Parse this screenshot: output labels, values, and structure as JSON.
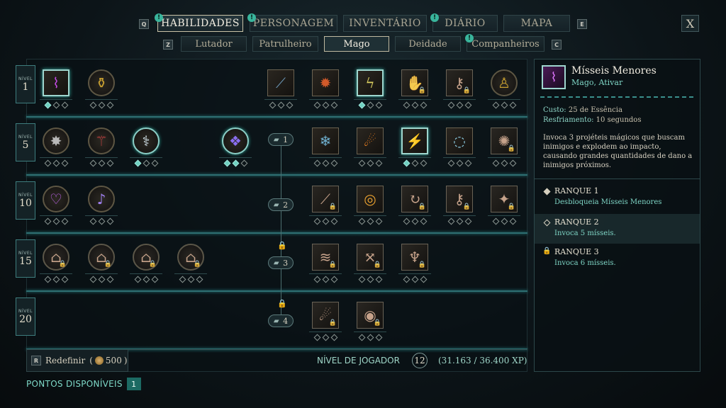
{
  "nav": {
    "keys": {
      "left": "Q",
      "right": "E",
      "sub_left": "Z",
      "sub_right": "C"
    },
    "tabs": [
      {
        "label": "HABILIDADES",
        "active": true,
        "notify": true
      },
      {
        "label": "PERSONAGEM",
        "active": false,
        "notify": true
      },
      {
        "label": "INVENTÁRIO",
        "active": false,
        "notify": false
      },
      {
        "label": "DIÁRIO",
        "active": false,
        "notify": true
      },
      {
        "label": "MAPA",
        "active": false,
        "notify": false
      }
    ],
    "close": "X",
    "notify_glyph": "!",
    "subtabs": [
      {
        "label": "Lutador",
        "active": false
      },
      {
        "label": "Patrulheiro",
        "active": false
      },
      {
        "label": "Mago",
        "active": true
      },
      {
        "label": "Deidade",
        "active": false
      },
      {
        "label": "Companheiros",
        "active": false,
        "notify": true
      }
    ]
  },
  "tree": {
    "level_word": "NÍVEL",
    "levels": [
      "1",
      "5",
      "10",
      "15",
      "20"
    ],
    "passive_points": [
      "1",
      "2",
      "3",
      "4"
    ],
    "skills": [
      {
        "icon": "arcane-tentacles-icon",
        "level": "1",
        "shape": "square",
        "active": true,
        "ranks": 1,
        "color": "#c04ae0",
        "glyph": "⌇"
      },
      {
        "icon": "golden-armor-icon",
        "level": "1",
        "shape": "circle",
        "active": false,
        "ranks": 0,
        "color": "#c9a030",
        "glyph": "⚱"
      },
      {
        "icon": "claw-slash-icon",
        "level": "1",
        "shape": "square",
        "active": false,
        "ranks": 0,
        "color": "#6c98b8",
        "glyph": "⟋"
      },
      {
        "icon": "fan-fire-icon",
        "level": "1",
        "shape": "square",
        "active": false,
        "ranks": 0,
        "color": "#d25a2a",
        "glyph": "✹"
      },
      {
        "icon": "lightning-bolts-icon",
        "level": "1",
        "shape": "square",
        "active": true,
        "ranks": 1,
        "color": "#dcd060",
        "glyph": "ϟ"
      },
      {
        "icon": "locked-hand-icon",
        "level": "1",
        "shape": "square",
        "locked": true,
        "ranks": 0,
        "color": "#d0a080",
        "glyph": "✋"
      },
      {
        "icon": "locked-wand-icon",
        "level": "1",
        "shape": "square",
        "locked": true,
        "ranks": 0,
        "color": "#d0a080",
        "glyph": "⚷"
      },
      {
        "icon": "golden-figure-icon",
        "level": "1",
        "shape": "circle",
        "active": false,
        "ranks": 0,
        "color": "#c9a030",
        "glyph": "♙"
      },
      {
        "icon": "spike-burst-icon",
        "level": "5",
        "shape": "circle",
        "active": false,
        "ranks": 0,
        "color": "#b8b8b8",
        "glyph": "✸"
      },
      {
        "icon": "crimson-wand-icon",
        "level": "5",
        "shape": "circle",
        "active": false,
        "ranks": 0,
        "color": "#c04040",
        "glyph": "⚚"
      },
      {
        "icon": "frost-staff-icon",
        "level": "5",
        "shape": "circle",
        "active": true,
        "ranks": 1,
        "color": "#d0e0e8",
        "glyph": "⚕"
      },
      {
        "icon": "spellbook-icon",
        "level": "5",
        "shape": "circle",
        "active": true,
        "ranks": 2,
        "color": "#8a6ef0",
        "glyph": "❖"
      },
      {
        "icon": "ice-shards-icon",
        "level": "5",
        "shape": "square",
        "active": false,
        "ranks": 0,
        "color": "#6fb0d0",
        "glyph": "❄"
      },
      {
        "icon": "fireball-icon",
        "level": "5",
        "shape": "square",
        "active": false,
        "ranks": 0,
        "color": "#f08020",
        "glyph": "☄"
      },
      {
        "icon": "lightning-chain-icon",
        "level": "5",
        "shape": "square",
        "active": true,
        "ranks": 1,
        "color": "#f0d060",
        "glyph": "⚡"
      },
      {
        "icon": "frost-ring-icon",
        "level": "5",
        "shape": "square",
        "active": false,
        "ranks": 0,
        "color": "#8fd0e8",
        "glyph": "◌"
      },
      {
        "icon": "locked-shatter-icon",
        "level": "5",
        "shape": "square",
        "locked": true,
        "ranks": 0,
        "color": "#d0a080",
        "glyph": "✺"
      },
      {
        "icon": "arcane-heart-icon",
        "level": "10",
        "shape": "circle",
        "active": false,
        "ranks": 0,
        "color": "#c064f0",
        "glyph": "♡"
      },
      {
        "icon": "arcane-swirl-icon",
        "level": "10",
        "shape": "circle",
        "active": false,
        "ranks": 0,
        "color": "#a080f0",
        "glyph": "♪"
      },
      {
        "icon": "locked-claws-icon",
        "level": "10",
        "shape": "square",
        "locked": true,
        "ranks": 0,
        "color": "#d0a080",
        "glyph": "⟋"
      },
      {
        "icon": "fire-ring-icon",
        "level": "10",
        "shape": "square",
        "active": false,
        "ranks": 0,
        "color": "#e8a030",
        "glyph": "◎"
      },
      {
        "icon": "locked-spiral-icon",
        "level": "10",
        "shape": "square",
        "locked": true,
        "ranks": 0,
        "color": "#d0a080",
        "glyph": "↻"
      },
      {
        "icon": "locked-staff-icon",
        "level": "10",
        "shape": "square",
        "locked": true,
        "ranks": 0,
        "color": "#d0a080",
        "glyph": "⚷"
      },
      {
        "icon": "locked-lantern-icon",
        "level": "10",
        "shape": "square",
        "locked": true,
        "ranks": 0,
        "color": "#d0a080",
        "glyph": "✦"
      },
      {
        "icon": "locked-shrine-icon",
        "level": "15",
        "shape": "circle",
        "locked": true,
        "ranks": 0,
        "color": "#d0a080",
        "glyph": "⌂"
      },
      {
        "icon": "locked-shrine-icon",
        "level": "15",
        "shape": "circle",
        "locked": true,
        "ranks": 0,
        "color": "#d0a080",
        "glyph": "⌂"
      },
      {
        "icon": "locked-shrine-icon",
        "level": "15",
        "shape": "circle",
        "locked": true,
        "ranks": 0,
        "color": "#d0a080",
        "glyph": "⌂"
      },
      {
        "icon": "locked-shrine-icon",
        "level": "15",
        "shape": "circle",
        "locked": true,
        "ranks": 0,
        "color": "#d0a080",
        "glyph": "⌂"
      },
      {
        "icon": "locked-wave-icon",
        "level": "15",
        "shape": "square",
        "locked": true,
        "ranks": 0,
        "color": "#d0a080",
        "glyph": "≋"
      },
      {
        "icon": "locked-arrows-icon",
        "level": "15",
        "shape": "square",
        "locked": true,
        "ranks": 0,
        "color": "#d0a080",
        "glyph": "⤧"
      },
      {
        "icon": "locked-totem-icon",
        "level": "15",
        "shape": "square",
        "locked": true,
        "ranks": 0,
        "color": "#d0a080",
        "glyph": "♆"
      },
      {
        "icon": "locked-meteor-icon",
        "level": "20",
        "shape": "square",
        "locked": true,
        "ranks": 0,
        "color": "#d0a080",
        "glyph": "☄"
      },
      {
        "icon": "locked-rune-icon",
        "level": "20",
        "shape": "square",
        "locked": true,
        "ranks": 0,
        "color": "#d0a080",
        "glyph": "◉"
      }
    ]
  },
  "detail": {
    "icon": "arcane-missiles-icon",
    "name": "Mísseis Menores",
    "subtitle": "Mago, Ativar",
    "cost_label": "Custo:",
    "cost_value": "25 de Essência",
    "cooldown_label": "Resfriamento:",
    "cooldown_value": "10 segundos",
    "description": "Invoca 3 projéteis mágicos que buscam inimigos e explodem ao impacto, causando grandes quantidades de dano a inimigos próximos.",
    "ranks": [
      {
        "title": "RANQUE 1",
        "desc": "Desbloqueia Mísseis Menores",
        "state": "unlocked"
      },
      {
        "title": "RANQUE 2",
        "desc": "Invoca 5 mísseis.",
        "state": "available"
      },
      {
        "title": "RANQUE 3",
        "desc": "Invoca 6 mísseis.",
        "state": "locked"
      }
    ]
  },
  "footer": {
    "reset_key": "R",
    "reset_label": "Redefinir",
    "reset_cost": "500",
    "player_level_label": "NÍVEL DE JOGADOR",
    "player_level": "12",
    "xp": "(31.163 / 36.400 XP)",
    "points_label": "PONTOS DISPONÍVEIS",
    "points": "1"
  },
  "colors": {
    "accent": "#3fa9a0",
    "lock": "#d98a3e",
    "active_border": "#9fd6ce"
  }
}
